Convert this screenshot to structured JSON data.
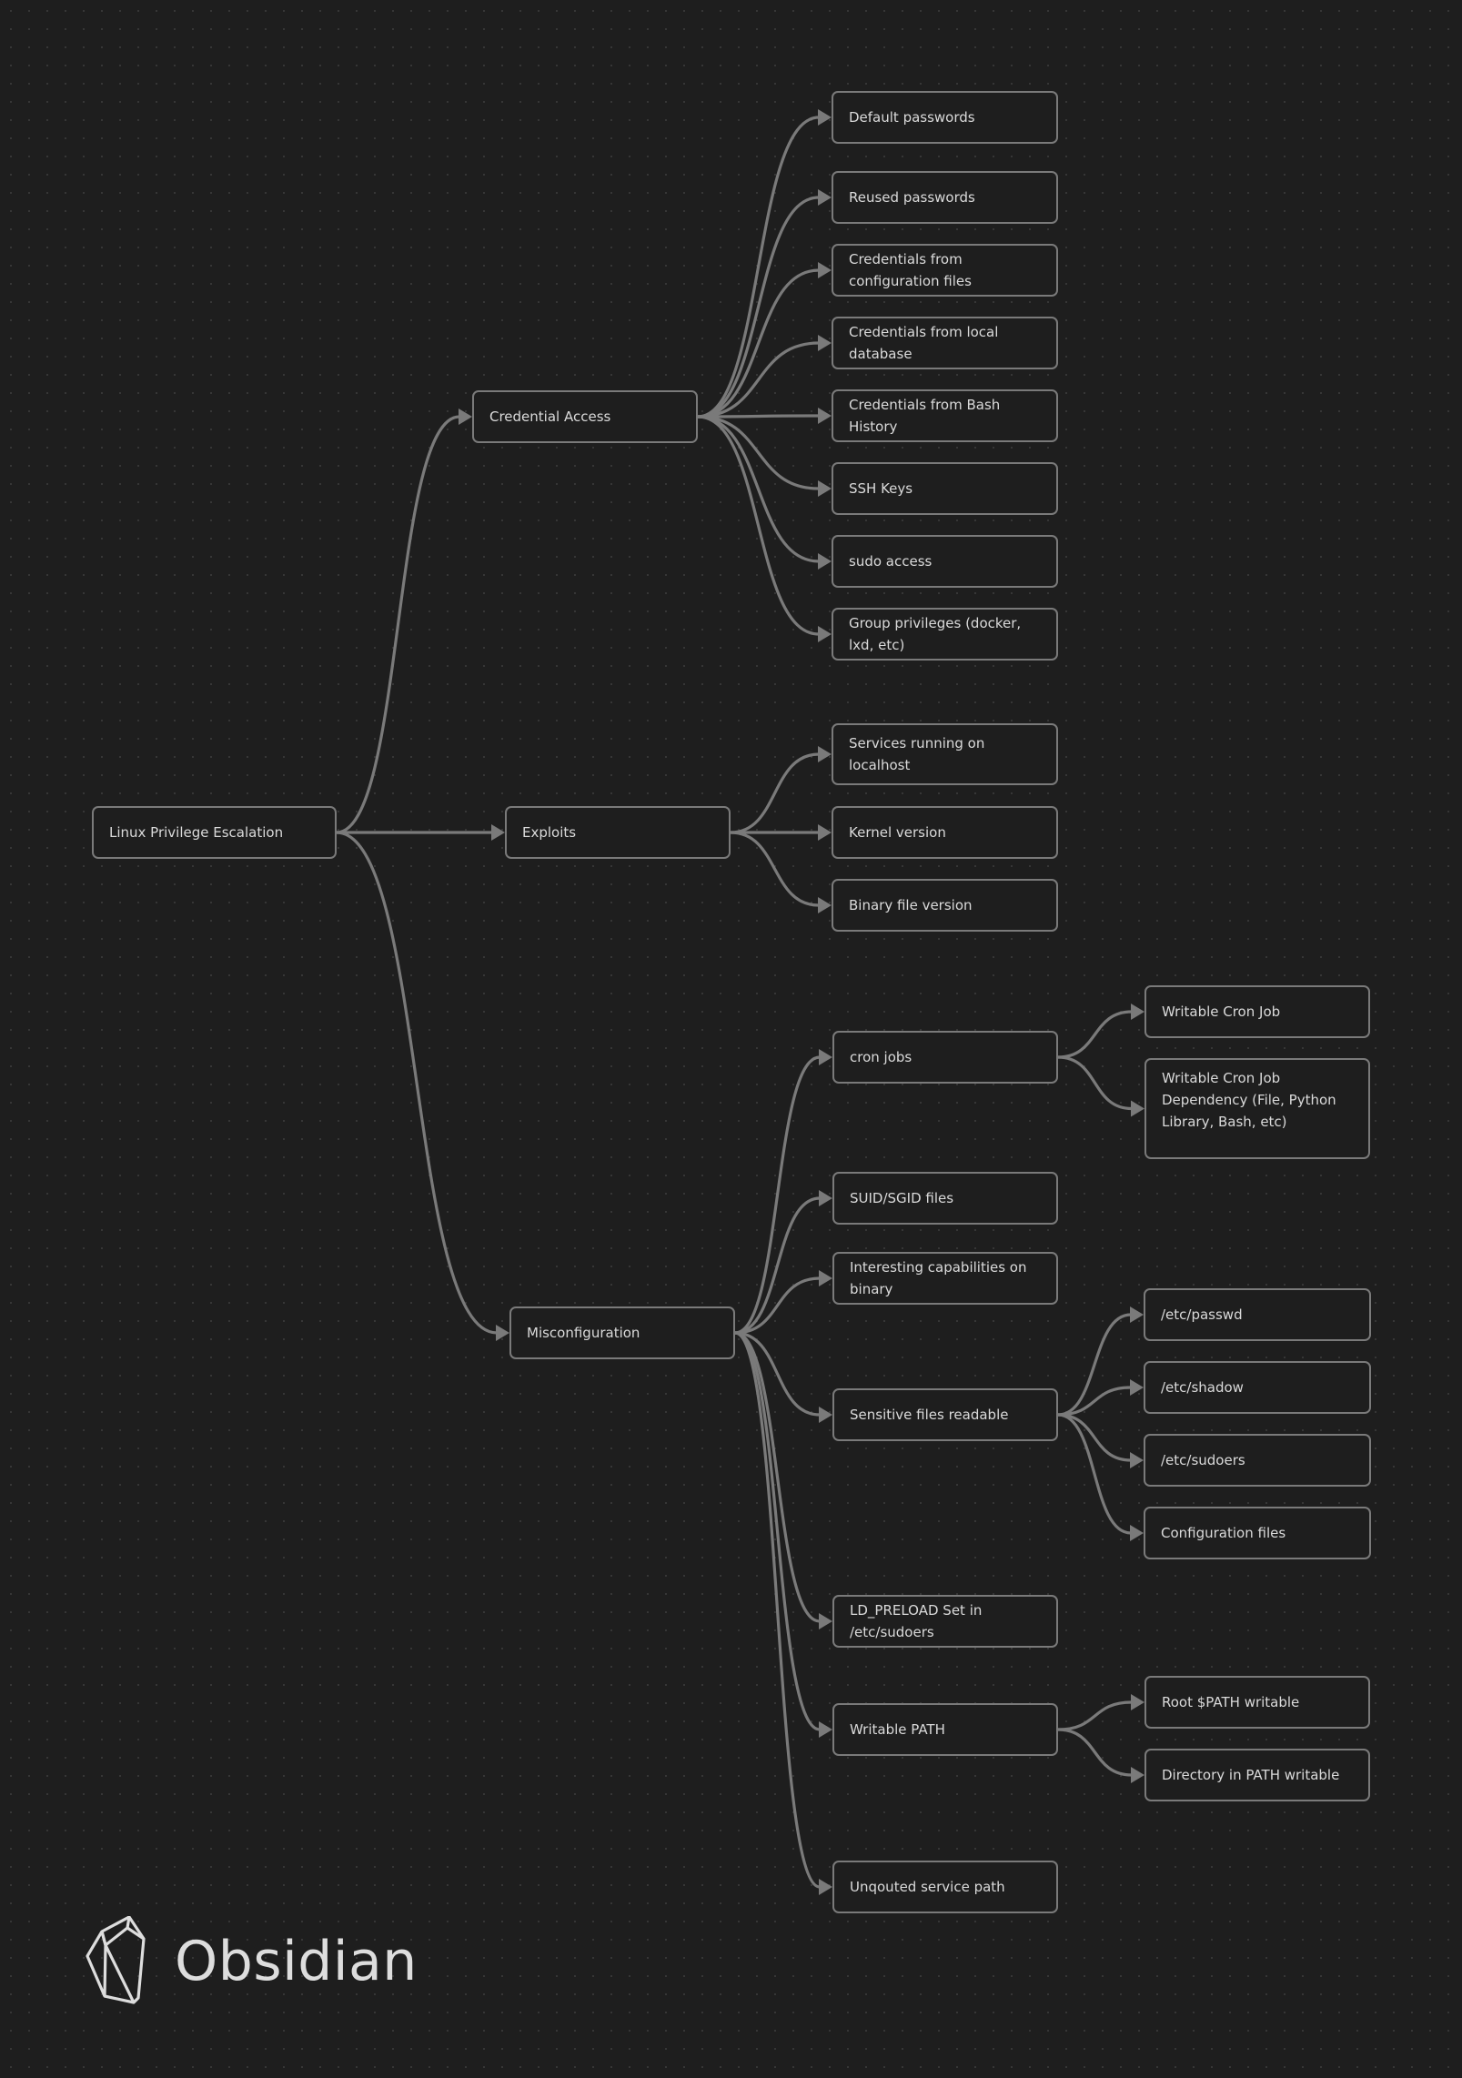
{
  "canvas": {
    "colors": {
      "background": "#1e1e1e",
      "node_border": "#7a7a7a",
      "edge": "#7a7a7a",
      "text": "#dadada"
    }
  },
  "nodes": [
    {
      "id": "root",
      "label": "Linux Privilege Escalation"
    },
    {
      "id": "cred",
      "label": "Credential Access"
    },
    {
      "id": "exploits",
      "label": "Exploits"
    },
    {
      "id": "misconf",
      "label": "Misconfiguration"
    },
    {
      "id": "c1",
      "label": "Default passwords"
    },
    {
      "id": "c2",
      "label": "Reused passwords"
    },
    {
      "id": "c3",
      "label": "Credentials from configuration files"
    },
    {
      "id": "c4",
      "label": "Credentials from local database"
    },
    {
      "id": "c5",
      "label": "Credentials from Bash History"
    },
    {
      "id": "c6",
      "label": "SSH Keys"
    },
    {
      "id": "c7",
      "label": "sudo access"
    },
    {
      "id": "c8",
      "label": "Group privileges (docker, lxd, etc)"
    },
    {
      "id": "e1",
      "label": "Services running on localhost"
    },
    {
      "id": "e2",
      "label": "Kernel version"
    },
    {
      "id": "e3",
      "label": "Binary file version"
    },
    {
      "id": "m1",
      "label": "cron jobs"
    },
    {
      "id": "m1a",
      "label": "Writable Cron Job"
    },
    {
      "id": "m1b",
      "label": "Writable Cron Job Dependency (File, Python Library, Bash, etc)"
    },
    {
      "id": "m2",
      "label": "SUID/SGID files"
    },
    {
      "id": "m3",
      "label": "Interesting capabilities on binary"
    },
    {
      "id": "m4",
      "label": "Sensitive files readable"
    },
    {
      "id": "m4a",
      "label": "/etc/passwd"
    },
    {
      "id": "m4b",
      "label": "/etc/shadow"
    },
    {
      "id": "m4c",
      "label": "/etc/sudoers"
    },
    {
      "id": "m4d",
      "label": "Configuration files"
    },
    {
      "id": "m5",
      "label": "LD_PRELOAD Set in /etc/sudoers"
    },
    {
      "id": "m6",
      "label": "Writable PATH"
    },
    {
      "id": "m6a",
      "label": "Root $PATH writable"
    },
    {
      "id": "m6b",
      "label": "Directory in PATH writable"
    },
    {
      "id": "m7",
      "label": "Unqouted service path"
    }
  ],
  "edges": [
    [
      "root",
      "cred"
    ],
    [
      "root",
      "exploits"
    ],
    [
      "root",
      "misconf"
    ],
    [
      "cred",
      "c1"
    ],
    [
      "cred",
      "c2"
    ],
    [
      "cred",
      "c3"
    ],
    [
      "cred",
      "c4"
    ],
    [
      "cred",
      "c5"
    ],
    [
      "cred",
      "c6"
    ],
    [
      "cred",
      "c7"
    ],
    [
      "cred",
      "c8"
    ],
    [
      "exploits",
      "e1"
    ],
    [
      "exploits",
      "e2"
    ],
    [
      "exploits",
      "e3"
    ],
    [
      "misconf",
      "m1"
    ],
    [
      "misconf",
      "m2"
    ],
    [
      "misconf",
      "m3"
    ],
    [
      "misconf",
      "m4"
    ],
    [
      "misconf",
      "m5"
    ],
    [
      "misconf",
      "m6"
    ],
    [
      "misconf",
      "m7"
    ],
    [
      "m1",
      "m1a"
    ],
    [
      "m1",
      "m1b"
    ],
    [
      "m4",
      "m4a"
    ],
    [
      "m4",
      "m4b"
    ],
    [
      "m4",
      "m4c"
    ],
    [
      "m4",
      "m4d"
    ],
    [
      "m6",
      "m6a"
    ],
    [
      "m6",
      "m6b"
    ]
  ],
  "branding": {
    "logo_text": "Obsidian",
    "logo_icon": "obsidian-crystal-icon"
  }
}
